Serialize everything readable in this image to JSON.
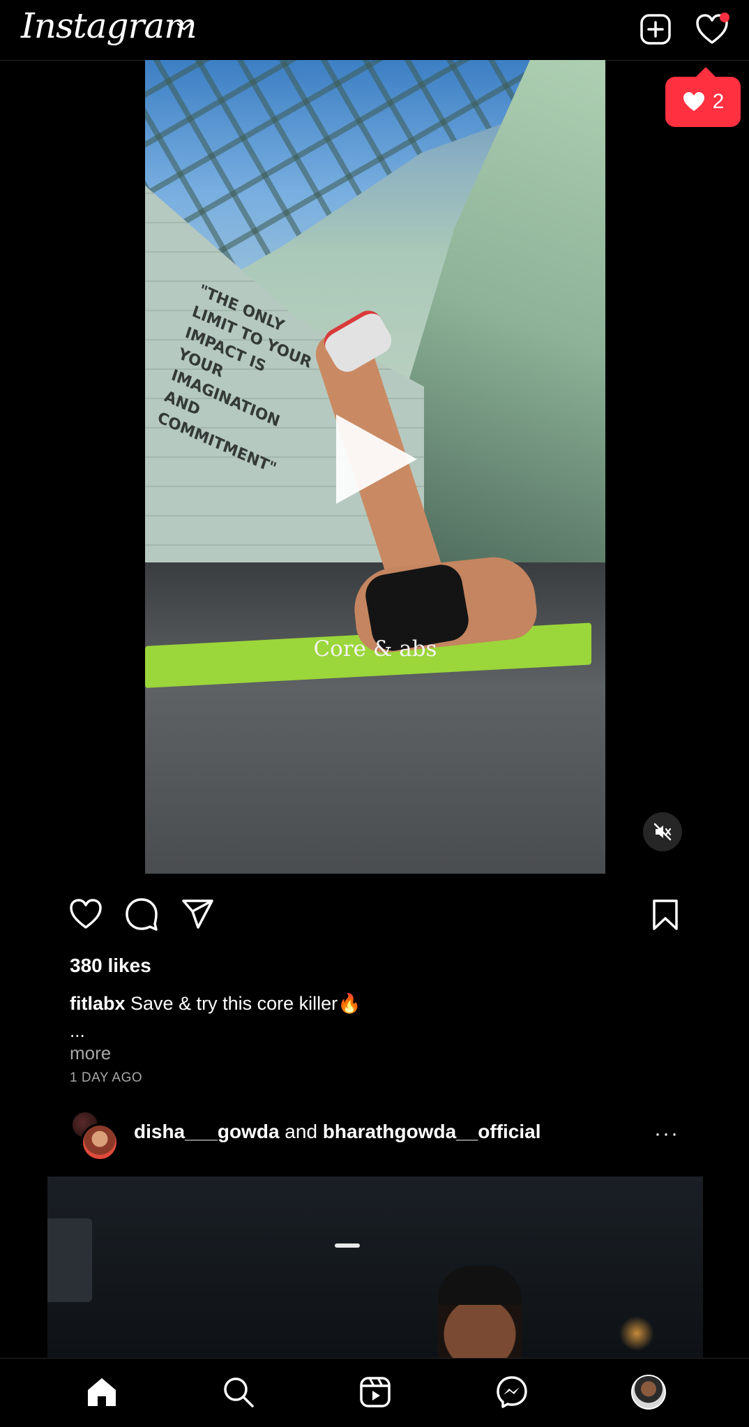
{
  "header": {
    "logo_text": "Instagram",
    "notification_dot_color": "#ff3040"
  },
  "activity_bubble": {
    "likes_count": "2",
    "color": "#ff3040"
  },
  "post1": {
    "video_caption": "Core & abs",
    "wall_quote": "\"THE ONLY LIMIT TO YOUR IMPACT IS YOUR IMAGINATION AND COMMITMENT\"",
    "likes": "380 likes",
    "username": "fitlabx",
    "caption": "Save & try this core killer",
    "caption_emoji": "🔥",
    "ellipsis": "...",
    "more": "more",
    "time": "1 DAY AGO"
  },
  "post2": {
    "user1": "disha___gowda",
    "connector": "and",
    "user2": "bharathgowda__official",
    "more_icon": "···"
  },
  "bottom_nav": {
    "items": [
      "home-icon",
      "search-icon",
      "reels-icon",
      "messenger-icon",
      "profile-avatar"
    ]
  }
}
